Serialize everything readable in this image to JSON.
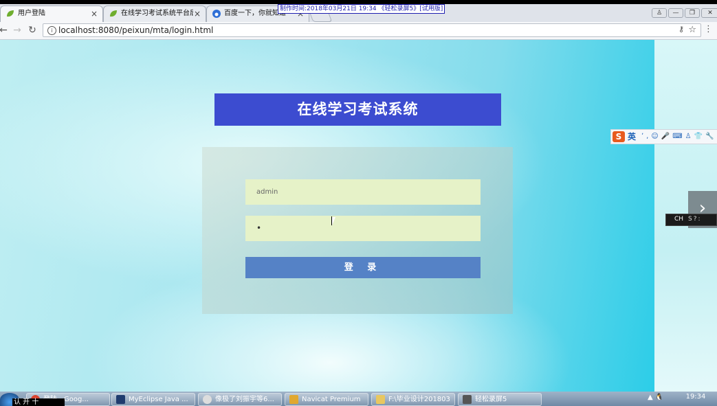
{
  "screen_watermark": "制作时间:2018年03月21日 19:34 《轻松录屏5》[试用版]",
  "browser": {
    "tabs": [
      {
        "label": "用户登陆",
        "active": true
      },
      {
        "label": "在线学习考试系统平台后",
        "active": false
      },
      {
        "label": "百度一下，你就知道",
        "active": false
      }
    ],
    "tab_close": "×",
    "address": "localhost:8080/peixun/mta/login.html",
    "info_icon": "i",
    "window_controls": {
      "user": "♙",
      "minimize": "—",
      "restore": "❐",
      "close": "✕"
    },
    "nav": {
      "back": "←",
      "forward": "→",
      "reload": "↻"
    },
    "key_icon": "⚷",
    "star_icon": "☆",
    "menu_icon": "⋮"
  },
  "page": {
    "title": "在线学习考试系统",
    "username_value": "admin",
    "password_value": "•",
    "login_label": "登 录"
  },
  "ime": {
    "logo": "S",
    "mode": "英",
    "icons": "ʼ,☺🎤⌨♙👕🔧"
  },
  "overlay": {
    "next_arrow": "›",
    "lang": "CH",
    "lang_icons": "S?:"
  },
  "taskbar": {
    "start_text": "认 开 十",
    "items": [
      {
        "label": "登陆 - Goog..."
      },
      {
        "label": "MyEclipse Java ..."
      },
      {
        "label": "像极了刘振宇等6..."
      },
      {
        "label": "Navicat Premium"
      },
      {
        "label": "F:\\毕业设计201803"
      },
      {
        "label": "轻松录屏5"
      }
    ],
    "clock": "19:34",
    "tray_icons": "▲ 🐧"
  },
  "colors": {
    "banner": "#3c4cd0",
    "field_bg": "#e6f2c8",
    "login_button": "#5582c6"
  }
}
